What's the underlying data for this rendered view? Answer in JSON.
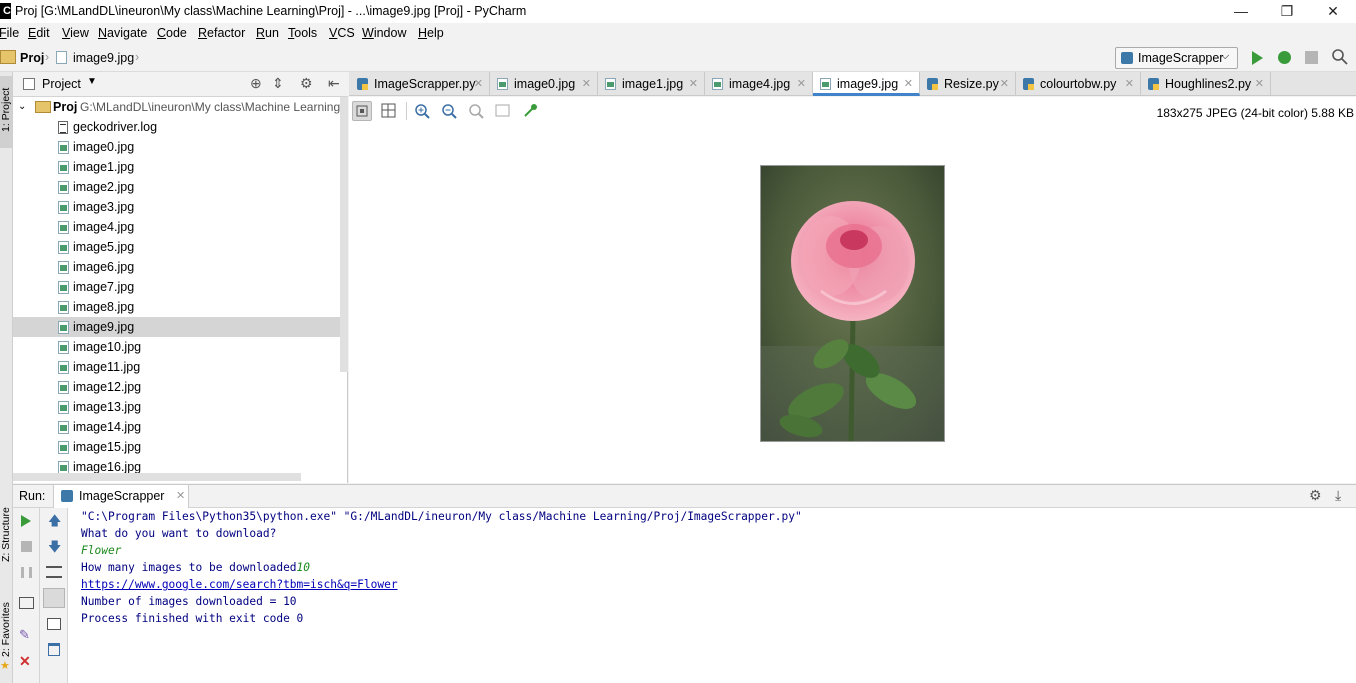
{
  "window": {
    "title": "Proj [G:\\MLandDL\\ineuron\\My class\\Machine Learning\\Proj] - ...\\image9.jpg [Proj] - PyCharm",
    "minimize_glyph": "—",
    "maximize_glyph": "❐",
    "close_glyph": "✕"
  },
  "menu": {
    "items": [
      {
        "label": "ile",
        "mnemonic": "F"
      },
      {
        "label": "dit",
        "mnemonic": "E"
      },
      {
        "label": "iew",
        "mnemonic": "V"
      },
      {
        "label": "avigate",
        "mnemonic": "N"
      },
      {
        "label": "ode",
        "mnemonic": "C"
      },
      {
        "label": "efactor",
        "mnemonic": "R"
      },
      {
        "label": "un",
        "mnemonic": "R"
      },
      {
        "label": "ools",
        "mnemonic": "T"
      },
      {
        "label": "CS",
        "mnemonic": "V"
      },
      {
        "label": "indow",
        "mnemonic": "W"
      },
      {
        "label": "elp",
        "mnemonic": "H"
      }
    ]
  },
  "breadcrumb": {
    "project": "Proj",
    "file": "image9.jpg"
  },
  "run_config": {
    "selected": "ImageScrapper"
  },
  "left_stripe": {
    "project_tab": "1: Project",
    "structure_tab": "Z: Structure",
    "favorites_tab": "2: Favorites"
  },
  "project_panel": {
    "header": "Project",
    "root_name": "Proj",
    "root_path": "G:\\MLandDL\\ineuron\\My class\\Machine Learning\\",
    "files": [
      "geckodriver.log",
      "image0.jpg",
      "image1.jpg",
      "image2.jpg",
      "image3.jpg",
      "image4.jpg",
      "image5.jpg",
      "image6.jpg",
      "image7.jpg",
      "image8.jpg",
      "image9.jpg",
      "image10.jpg",
      "image11.jpg",
      "image12.jpg",
      "image13.jpg",
      "image14.jpg",
      "image15.jpg",
      "image16.jpg"
    ],
    "selected_file": "image9.jpg"
  },
  "tabs": [
    {
      "label": "ImageScrapper.py",
      "kind": "py"
    },
    {
      "label": "image0.jpg",
      "kind": "img"
    },
    {
      "label": "image1.jpg",
      "kind": "img"
    },
    {
      "label": "image4.jpg",
      "kind": "img"
    },
    {
      "label": "image9.jpg",
      "kind": "img",
      "active": true
    },
    {
      "label": "Resize.py",
      "kind": "py"
    },
    {
      "label": "colourtobw.py",
      "kind": "py"
    },
    {
      "label": "Houghlines2.py",
      "kind": "py"
    }
  ],
  "viewer": {
    "image_info": "183x275 JPEG (24-bit color) 5.88 KB"
  },
  "run_panel": {
    "label": "Run:",
    "tab": "ImageScrapper",
    "console": [
      {
        "text": "\"C:\\Program Files\\Python35\\python.exe\" \"G:/MLandDL/ineuron/My class/Machine Learning/Proj/ImageScrapper.py\"",
        "style": "cmd"
      },
      {
        "text": "What do you want to download?",
        "style": "out"
      },
      {
        "text": "Flower",
        "style": "in"
      },
      {
        "text": "How many images to be downloaded",
        "style": "out",
        "suffix": "10"
      },
      {
        "text": "https://www.google.com/search?tbm=isch&q=Flower",
        "style": "link"
      },
      {
        "text": "Number of images downloaded = 10",
        "style": "out"
      },
      {
        "text": "",
        "style": "out"
      },
      {
        "text": "Process finished with exit code 0",
        "style": "out"
      }
    ]
  },
  "colors": {
    "accent": "#4083c9",
    "run_green": "#3a9b3a",
    "console_blue": "#000080",
    "input_green": "#1c8a1c"
  }
}
